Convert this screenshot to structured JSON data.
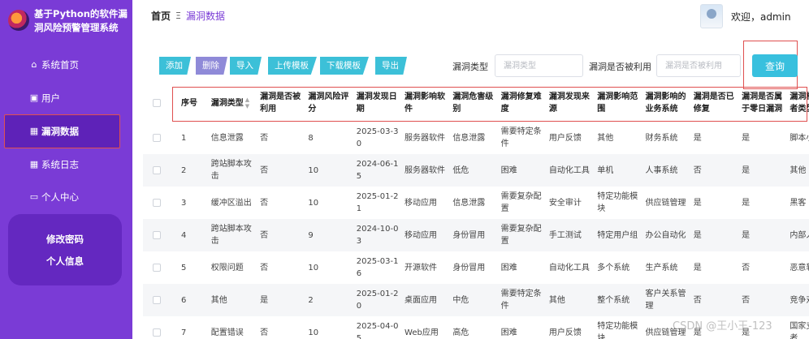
{
  "app": {
    "title": "基于Python的软件漏洞风险预警管理系统"
  },
  "sidebar": {
    "items": [
      {
        "icon": "home-icon",
        "glyph": "⌂",
        "label": "系统首页"
      },
      {
        "icon": "user-icon",
        "glyph": "▣",
        "label": "用户"
      },
      {
        "icon": "grid-icon",
        "glyph": "▦",
        "label": "漏洞数据",
        "active": true
      },
      {
        "icon": "grid-icon",
        "glyph": "▦",
        "label": "系统日志"
      },
      {
        "icon": "card-icon",
        "glyph": "▭",
        "label": "个人中心"
      }
    ],
    "sub_items": [
      "修改密码",
      "个人信息"
    ]
  },
  "header": {
    "breadcrumb_home": "首页",
    "breadcrumb_sep": "Ξ",
    "breadcrumb_current": "漏洞数据",
    "welcome": "欢迎，admin"
  },
  "toolbar": {
    "buttons": [
      "添加",
      "删除",
      "导入",
      "上传模板",
      "下载模板",
      "导出"
    ],
    "filter_type_label": "漏洞类型",
    "filter_type_placeholder": "漏洞类型",
    "filter_exploited_label": "漏洞是否被利用",
    "filter_exploited_placeholder": "漏洞是否被利用",
    "query_label": "查询"
  },
  "table": {
    "columns": [
      "序号",
      "漏洞类型",
      "漏洞是否被利用",
      "漏洞风险评分",
      "漏洞发现日期",
      "漏洞影响软件",
      "漏洞危害级别",
      "漏洞修复难度",
      "漏洞发现来源",
      "漏洞影响范围",
      "漏洞影响的业务系统",
      "漏洞是否已修复",
      "漏洞是否属于零日漏洞",
      "漏洞相关攻击者类型"
    ],
    "rows": [
      [
        "1",
        "信息泄露",
        "否",
        "8",
        "2025-03-30",
        "服务器软件",
        "信息泄露",
        "需要特定条件",
        "用户反馈",
        "其他",
        "财务系统",
        "是",
        "是",
        "脚本小子"
      ],
      [
        "2",
        "跨站脚本攻击",
        "否",
        "10",
        "2024-06-15",
        "服务器软件",
        "低危",
        "困难",
        "自动化工具",
        "单机",
        "人事系统",
        "否",
        "是",
        "其他"
      ],
      [
        "3",
        "缓冲区溢出",
        "否",
        "10",
        "2025-01-21",
        "移动应用",
        "信息泄露",
        "需要复杂配置",
        "安全审计",
        "特定功能模块",
        "供应链管理",
        "是",
        "是",
        "黑客"
      ],
      [
        "4",
        "跨站脚本攻击",
        "否",
        "9",
        "2024-10-03",
        "移动应用",
        "身份冒用",
        "需要复杂配置",
        "手工测试",
        "特定用户组",
        "办公自动化",
        "是",
        "是",
        "内部人员"
      ],
      [
        "5",
        "权限问题",
        "否",
        "10",
        "2025-03-16",
        "开源软件",
        "身份冒用",
        "困难",
        "自动化工具",
        "多个系统",
        "生产系统",
        "是",
        "否",
        "恶意软件"
      ],
      [
        "6",
        "其他",
        "是",
        "2",
        "2025-01-20",
        "桌面应用",
        "中危",
        "需要特定条件",
        "其他",
        "整个系统",
        "客户关系管理",
        "否",
        "否",
        "竞争对手"
      ],
      [
        "7",
        "配置错误",
        "否",
        "10",
        "2025-04-05",
        "Web应用",
        "高危",
        "困难",
        "用户反馈",
        "特定功能模块",
        "供应链管理",
        "是",
        "是",
        "国家支持攻击者"
      ]
    ]
  },
  "watermark": "CSDN @王小王-123"
}
